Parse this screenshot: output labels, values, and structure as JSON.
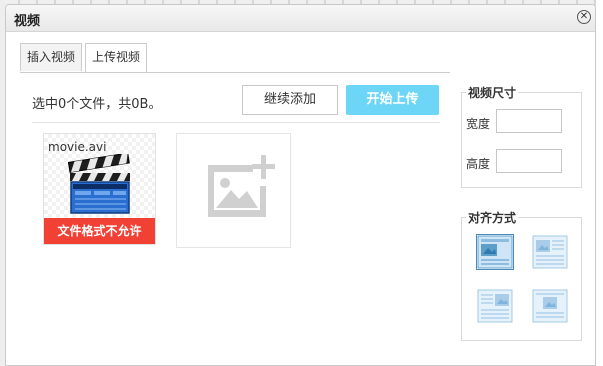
{
  "dialog": {
    "title": "视频"
  },
  "tabs": [
    {
      "label": "插入视频",
      "active": false
    },
    {
      "label": "上传视频",
      "active": true
    }
  ],
  "upload": {
    "status": "选中0个文件，共0B。",
    "continue_label": "继续添加",
    "start_label": "开始上传",
    "start_color": "#6dd5f5"
  },
  "files": [
    {
      "name": "movie.avi",
      "error": "文件格式不允许",
      "error_color": "#f04134"
    }
  ],
  "size_panel": {
    "title": "视频尺寸",
    "width_label": "宽度",
    "height_label": "高度",
    "width_value": "",
    "height_value": ""
  },
  "align_panel": {
    "title": "对齐方式",
    "options": [
      "none",
      "left",
      "right",
      "center"
    ],
    "selected": "none"
  }
}
